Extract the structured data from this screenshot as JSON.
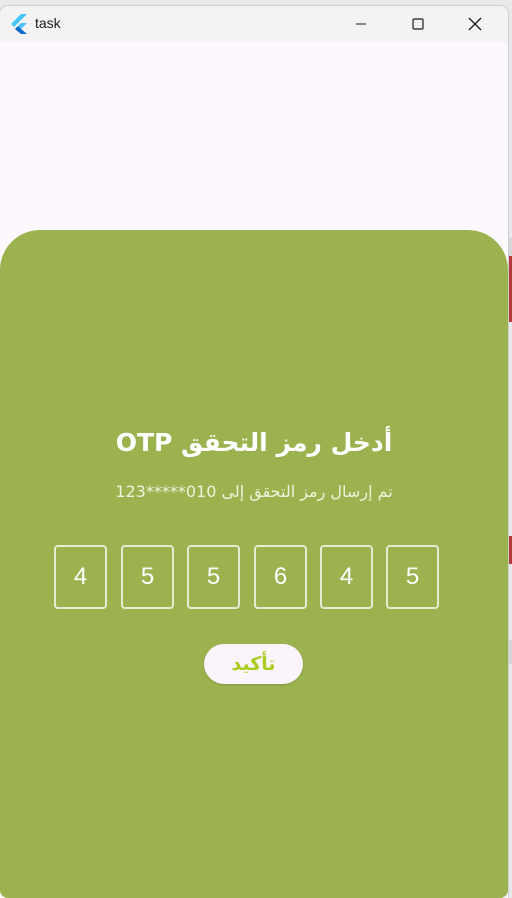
{
  "window": {
    "title": "task",
    "icon": "flutter-logo-icon"
  },
  "controls": {
    "minimize_icon": "minimize-icon",
    "maximize_icon": "maximize-icon",
    "close_icon": "close-icon"
  },
  "otp": {
    "title": "أدخل رمز التحقق OTP",
    "subtitle": "تم إرسال رمز التحقق إلى 010*****123",
    "digits": [
      "4",
      "5",
      "5",
      "6",
      "4",
      "5"
    ],
    "confirm_label": "تأكيد"
  },
  "colors": {
    "sheet": "#9bb24f",
    "page_bg": "#fdf7fe",
    "confirm_text": "#aacc1f",
    "box_border": "#e6ecd2"
  }
}
